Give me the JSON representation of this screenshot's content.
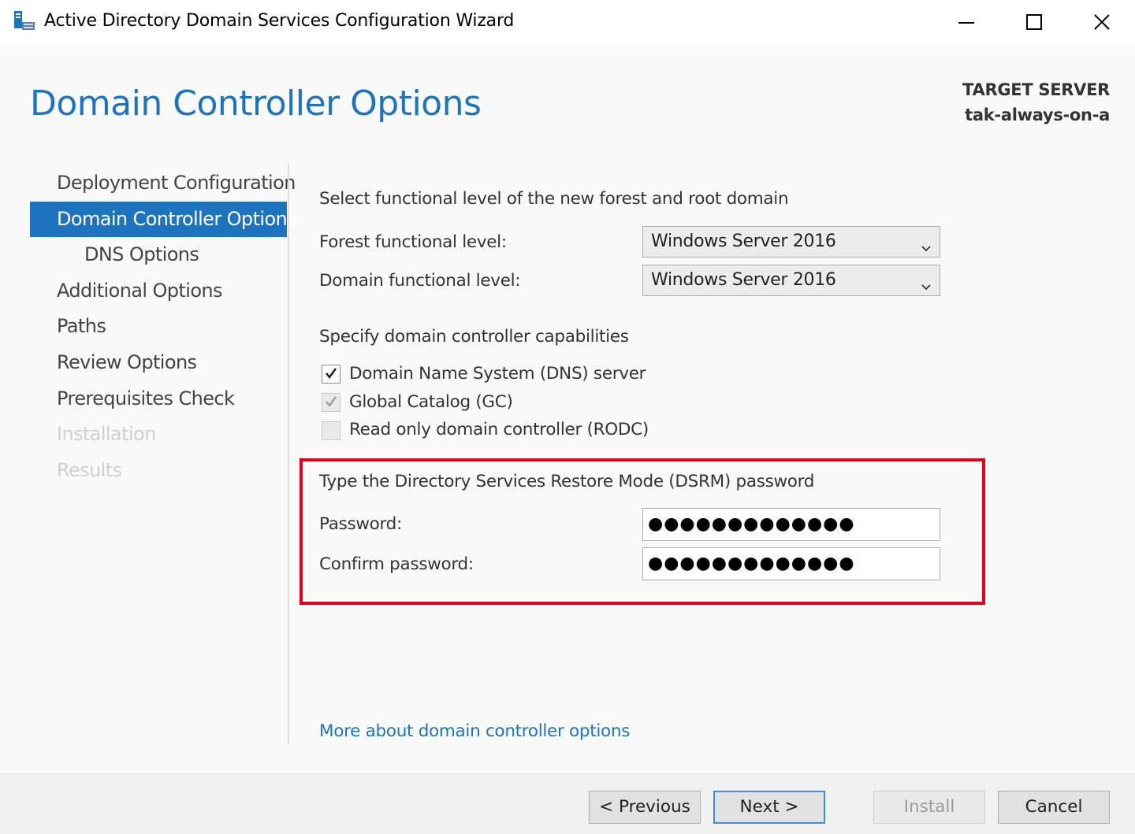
{
  "window": {
    "title": "Active Directory Domain Services Configuration Wizard",
    "controls": [
      "minimize-icon",
      "maximize-icon",
      "close-icon"
    ]
  },
  "header": {
    "page_title": "Domain Controller Options",
    "target_server_label": "TARGET SERVER",
    "target_server_value": "tak-always-on-a"
  },
  "nav": {
    "items": [
      {
        "label": "Deployment Configuration",
        "state": "normal"
      },
      {
        "label": "Domain Controller Options",
        "state": "active"
      },
      {
        "label": "DNS Options",
        "state": "sub"
      },
      {
        "label": "Additional Options",
        "state": "normal"
      },
      {
        "label": "Paths",
        "state": "normal"
      },
      {
        "label": "Review Options",
        "state": "normal"
      },
      {
        "label": "Prerequisites Check",
        "state": "normal"
      },
      {
        "label": "Installation",
        "state": "disabled"
      },
      {
        "label": "Results",
        "state": "disabled"
      }
    ]
  },
  "functional_level": {
    "heading": "Select functional level of the new forest and root domain",
    "forest_label": "Forest functional level:",
    "forest_value": "Windows Server 2016",
    "domain_label": "Domain functional level:",
    "domain_value": "Windows Server 2016"
  },
  "capabilities": {
    "heading": "Specify domain controller capabilities",
    "items": [
      {
        "label": "Domain Name System (DNS) server",
        "checked": true,
        "enabled": true
      },
      {
        "label": "Global Catalog (GC)",
        "checked": true,
        "enabled": false
      },
      {
        "label": "Read only domain controller (RODC)",
        "checked": false,
        "enabled": false
      }
    ]
  },
  "dsrm": {
    "heading": "Type the Directory Services Restore Mode (DSRM) password",
    "password_label": "Password:",
    "password_value": "●●●●●●●●●●●●●",
    "confirm_label": "Confirm password:",
    "confirm_value": "●●●●●●●●●●●●●"
  },
  "more_link": "More about domain controller options",
  "footer": {
    "previous_label": "< Previous",
    "next_label": "Next >",
    "install_label": "Install",
    "cancel_label": "Cancel"
  },
  "colors": {
    "accent": "#1e73be",
    "highlight": "#e2001a"
  }
}
